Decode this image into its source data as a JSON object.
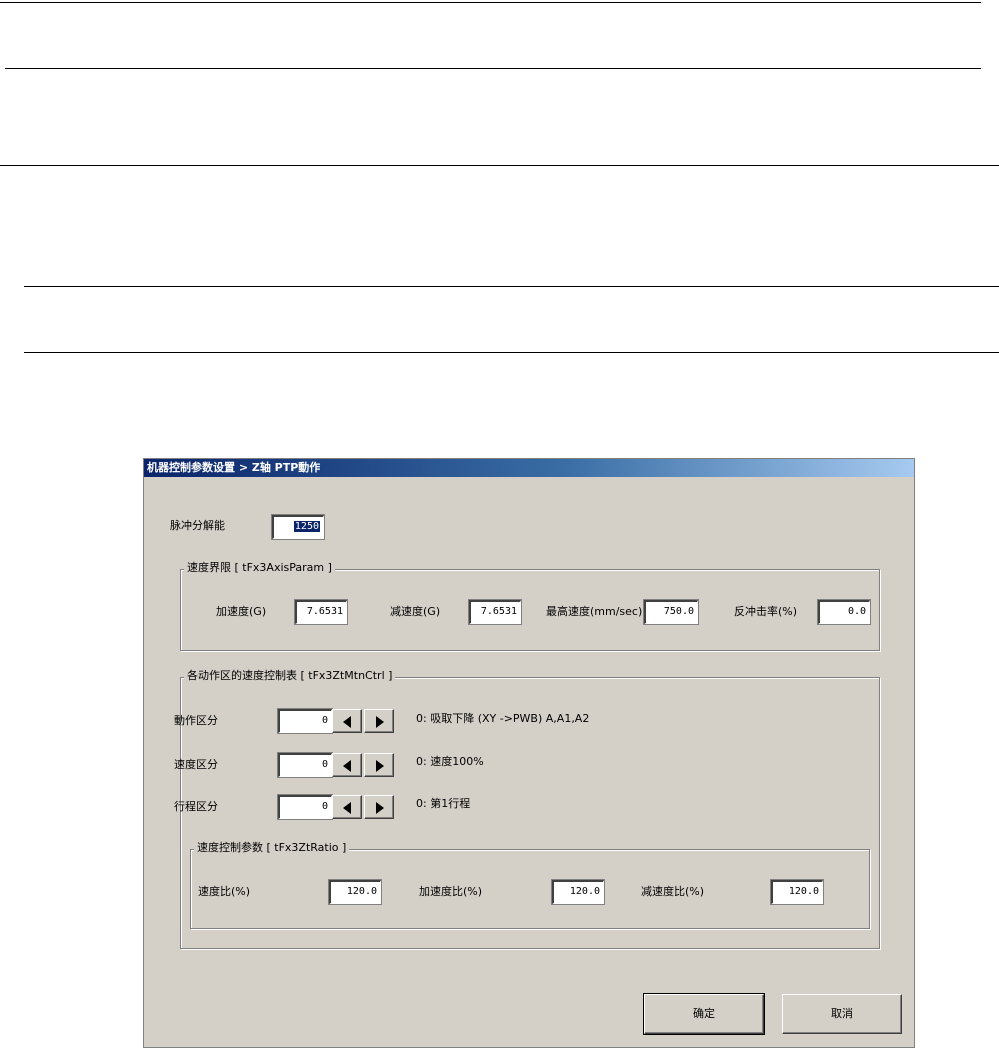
{
  "dialog": {
    "title": "机器控制参数设置 > Z轴 PTP動作",
    "pulse_resolution": {
      "label": "脉冲分解能",
      "value": "1250"
    },
    "speed_limits": {
      "title": "速度界限 [ tFx3AxisParam ]",
      "fields": [
        {
          "label": "加速度(G)",
          "value": "7.6531"
        },
        {
          "label": "减速度(G)",
          "value": "7.6531"
        },
        {
          "label": "最高速度(mm/sec)",
          "value": "750.0"
        },
        {
          "label": "反冲击率(%)",
          "value": "0.0"
        }
      ]
    },
    "zone_table": {
      "title": "各动作区的速度控制表 [ tFx3ZtMtnCtrl ]",
      "rows": [
        {
          "label": "動作区分",
          "value": "0",
          "info": "0: 吸取下降 (XY ->PWB) A,A1,A2"
        },
        {
          "label": "速度区分",
          "value": "0",
          "info": "0: 速度100%"
        },
        {
          "label": "行程区分",
          "value": "0",
          "info": "0: 第1行程"
        }
      ],
      "ratio_group": {
        "title": "速度控制参数 [ tFx3ZtRatio ]",
        "fields": [
          {
            "label": "速度比(%)",
            "value": "120.0"
          },
          {
            "label": "加速度比(%)",
            "value": "120.0"
          },
          {
            "label": "减速度比(%)",
            "value": "120.0"
          }
        ]
      }
    },
    "ok_label": "确定",
    "cancel_label": "取消"
  }
}
